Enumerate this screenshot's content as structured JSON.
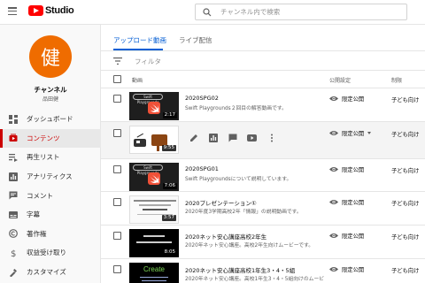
{
  "header": {
    "logo_text": "Studio",
    "search_placeholder": "チャンネル内で検索"
  },
  "channel": {
    "avatar_char": "健",
    "name": "チャンネル",
    "handle": "品田健"
  },
  "nav": [
    {
      "icon": "dashboard-icon",
      "label": "ダッシュボード"
    },
    {
      "icon": "content-icon",
      "label": "コンテンツ"
    },
    {
      "icon": "playlist-icon",
      "label": "再生リスト"
    },
    {
      "icon": "analytics-icon",
      "label": "アナリティクス"
    },
    {
      "icon": "comments-icon",
      "label": "コメント"
    },
    {
      "icon": "subtitles-icon",
      "label": "字幕"
    },
    {
      "icon": "copyright-icon",
      "label": "著作権"
    },
    {
      "icon": "monetization-icon",
      "label": "収益受け取り"
    },
    {
      "icon": "customize-icon",
      "label": "カスタマイズ"
    }
  ],
  "tabs": [
    "アップロード動画",
    "ライブ配信"
  ],
  "filter": {
    "label": "フィルタ"
  },
  "columns": {
    "video": "動画",
    "visibility": "公開設定",
    "restriction": "制限"
  },
  "videos": [
    {
      "title": "2020SPG02",
      "desc": "Swift Playgrounds２回目の解答動画です。",
      "duration": "2:17",
      "visibility": "限定公開",
      "restriction": "子ども向け",
      "thumb": "swift",
      "thumb_label": "Swift Playgrounds"
    },
    {
      "title": "",
      "desc": "",
      "duration": "9:55",
      "visibility": "限定公開",
      "restriction": "子ども向け",
      "thumb": "cow"
    },
    {
      "title": "2020SPG01",
      "desc": "Swift Playgroundsについて説明しています。",
      "duration": "7:06",
      "visibility": "限定公開",
      "restriction": "子ども向け",
      "thumb": "swift",
      "thumb_label": "Swift Playgrounds"
    },
    {
      "title": "2020プレゼンテーション①",
      "desc": "2020年度3学期高校2年「情報」の説明動画です。",
      "duration": "3:57",
      "visibility": "限定公開",
      "restriction": "子ども向け",
      "thumb": "slide"
    },
    {
      "title": "2020ネット安心講座高校2年生",
      "desc": "2020年ネット安心講座。高校2年生向けムービーです。",
      "duration": "8:05",
      "visibility": "限定公開",
      "restriction": "子ども向け",
      "thumb": "dark"
    },
    {
      "title": "2020ネット安心講座高校1年生3・4・5組",
      "desc": "2020年ネット安心講座。高校1年生3・4・5組向けのムービ",
      "duration": "",
      "visibility": "限定公開",
      "restriction": "子ども向け",
      "thumb": "create",
      "thumb_label": "Create"
    }
  ],
  "colors": {
    "accent": "#065fd4",
    "brand": "#ff0000",
    "active_nav": "#cc0000",
    "avatar": "#ef6c00",
    "swift": "#f05138"
  }
}
